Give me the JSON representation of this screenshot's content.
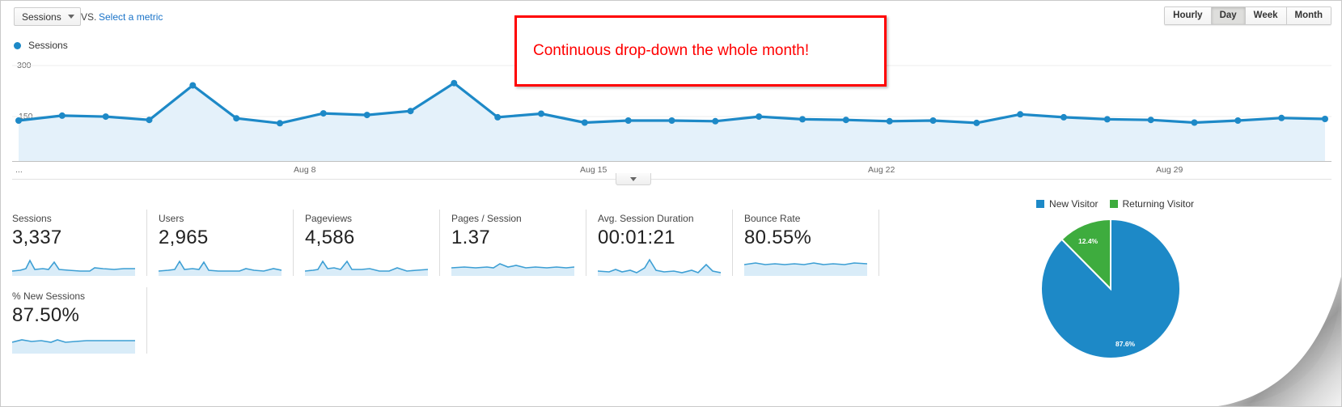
{
  "toolbar": {
    "metric_select_label": "Sessions",
    "vs_label": "VS.",
    "select_metric_link": "Select a metric",
    "periods": [
      {
        "label": "Hourly",
        "active": false
      },
      {
        "label": "Day",
        "active": true
      },
      {
        "label": "Week",
        "active": false
      },
      {
        "label": "Month",
        "active": false
      }
    ]
  },
  "series_legend": {
    "label": "Sessions",
    "color": "#1d89c7"
  },
  "annotation": {
    "text": "Continuous drop-down the whole month!",
    "border_color": "#ff0000",
    "text_color": "#ff0000"
  },
  "chart_data": {
    "type": "line",
    "title": "Sessions",
    "xlabel": "",
    "ylabel": "",
    "ylim": [
      0,
      300
    ],
    "yticks": [
      150,
      300
    ],
    "ytick_labels": [
      "150",
      "300"
    ],
    "grid": true,
    "legend_position": "top-left",
    "xtick_labels": [
      "...",
      "Aug 8",
      "Aug 15",
      "Aug 22",
      "Aug 29"
    ],
    "series": [
      {
        "name": "Sessions",
        "color": "#1d89c7",
        "fill": "#e3f1fa",
        "values": [
          118,
          133,
          130,
          120,
          225,
          125,
          110,
          140,
          135,
          147,
          232,
          128,
          139,
          112,
          118,
          118,
          116,
          130,
          122,
          120,
          116,
          118,
          111,
          137,
          128,
          122,
          120,
          112,
          118,
          126,
          123
        ]
      }
    ]
  },
  "metrics": [
    {
      "title": "Sessions",
      "value": "3,337"
    },
    {
      "title": "Users",
      "value": "2,965"
    },
    {
      "title": "Pageviews",
      "value": "4,586"
    },
    {
      "title": "Pages / Session",
      "value": "1.37"
    },
    {
      "title": "Avg. Session Duration",
      "value": "00:01:21"
    },
    {
      "title": "Bounce Rate",
      "value": "80.55%"
    },
    {
      "title": "% New Sessions",
      "value": "87.50%"
    }
  ],
  "pie": {
    "legend": [
      {
        "label": "New Visitor",
        "color": "#1d89c7"
      },
      {
        "label": "Returning Visitor",
        "color": "#3eac3e"
      }
    ],
    "chart_data": {
      "type": "pie",
      "title": "",
      "labels": [
        "New Visitor",
        "Returning Visitor"
      ],
      "values": [
        87.6,
        12.4
      ],
      "value_labels": [
        "87.6%",
        "12.4%"
      ],
      "colors": [
        "#1d89c7",
        "#3eac3e"
      ]
    }
  },
  "expander": {
    "icon": "chevron-down-icon"
  }
}
